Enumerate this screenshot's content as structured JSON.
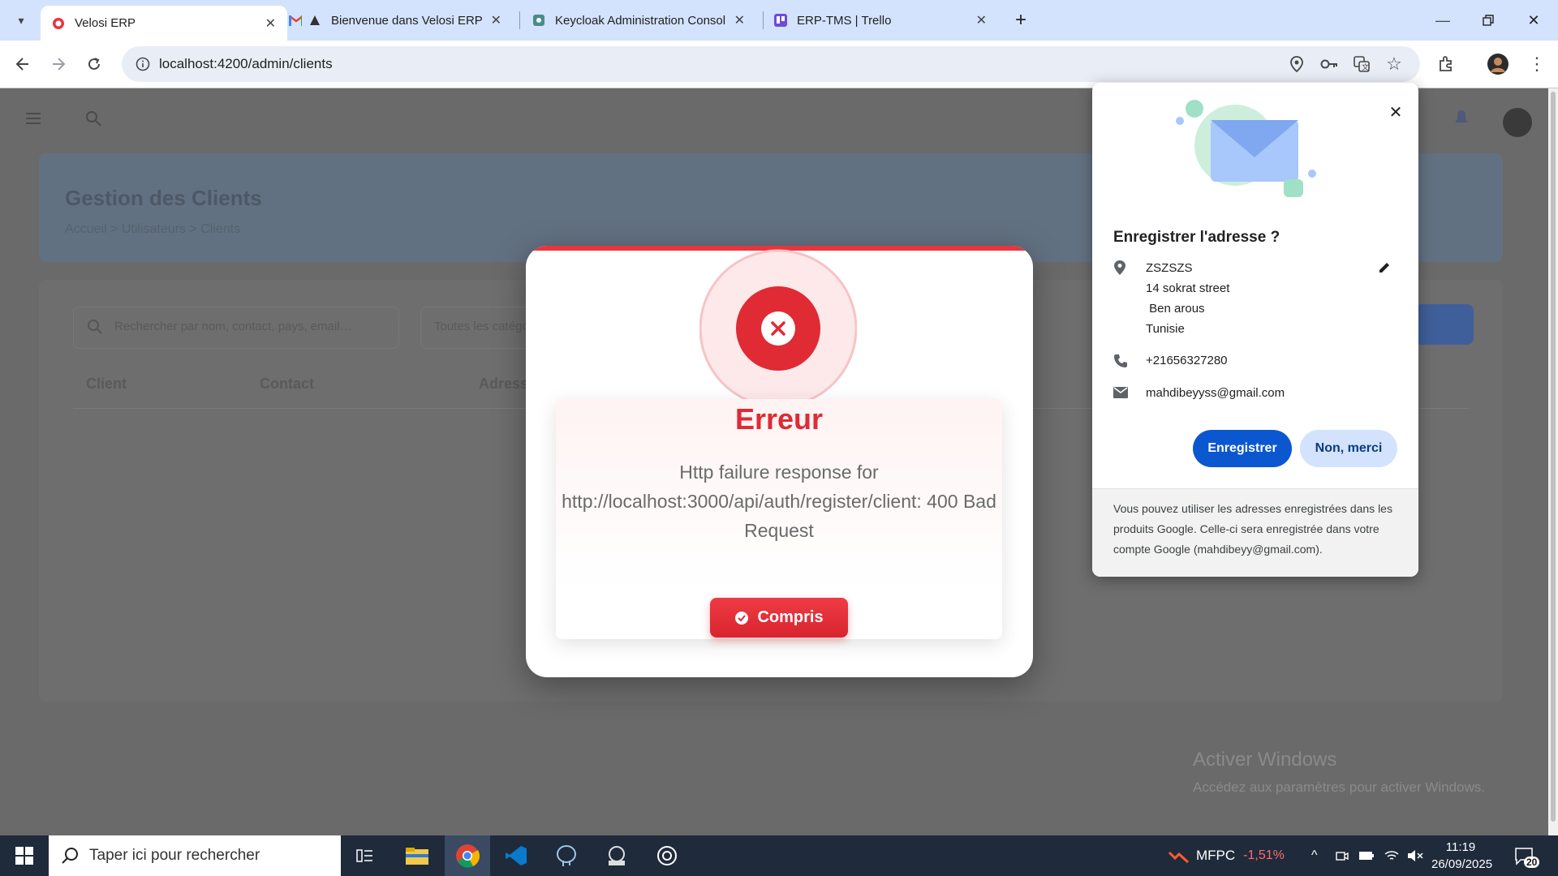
{
  "browser": {
    "tabs": [
      {
        "title": "Velosi ERP",
        "active": true
      },
      {
        "title": "Bienvenue dans Velosi ERP",
        "active": false
      },
      {
        "title": "Keycloak Administration Consol",
        "active": false
      },
      {
        "title": "ERP-TMS | Trello",
        "active": false
      }
    ],
    "url": "localhost:4200/admin/clients",
    "new_tab": "+"
  },
  "page": {
    "title": "Gestion des Clients",
    "subtitle": "Accueil > Utilisateurs > Clients",
    "search_placeholder": "Rechercher par nom, contact, pays, email…",
    "filter_label": "Toutes les catégories",
    "columns": [
      "Client",
      "Contact",
      "Adresse"
    ]
  },
  "error_modal": {
    "title": "Erreur",
    "message": "Http failure response for http://localhost:3000/api/auth/register/client: 400 Bad Request",
    "button": "Compris",
    "accent": "#e8353e"
  },
  "address_popup": {
    "heading": "Enregistrer l'adresse ?",
    "name": "ZSZSZS",
    "street": "14 sokrat street",
    "city": " Ben arous",
    "country": "Tunisie",
    "phone": "+21656327280",
    "email": "mahdibeyyss@gmail.com",
    "save": "Enregistrer",
    "decline": "Non, merci",
    "footer": "Vous pouvez utiliser les adresses enregistrées dans les produits Google. Celle-ci sera enregistrée dans votre compte Google (mahdibeyy@gmail.com)."
  },
  "watermark": {
    "title": "Activer Windows",
    "subtitle": "Accédez aux paramètres pour activer Windows."
  },
  "taskbar": {
    "search_placeholder": "Taper ici pour rechercher",
    "stock_label": "MFPC",
    "stock_change": "-1,51%",
    "time": "11:19",
    "date": "26/09/2025",
    "notifications": "20"
  }
}
